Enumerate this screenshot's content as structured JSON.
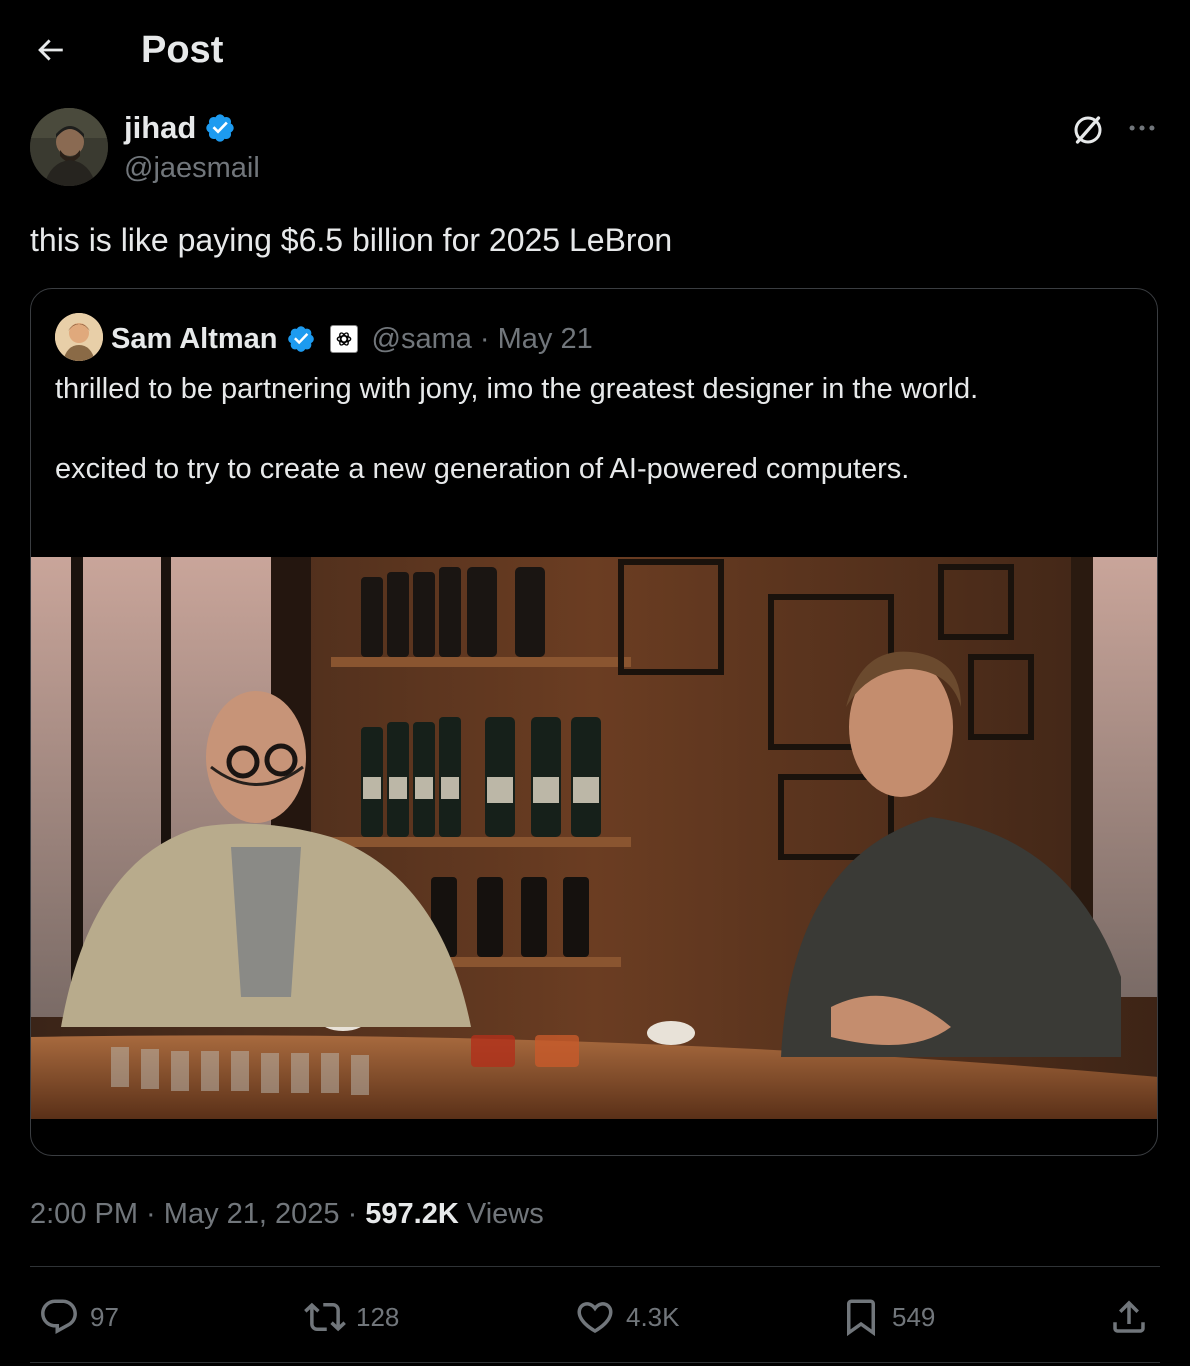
{
  "header": {
    "title": "Post",
    "back_icon": "arrow-left-icon"
  },
  "author": {
    "name": "jihad",
    "handle": "@jaesmail",
    "verified": true,
    "verified_color": "#1d9bf0"
  },
  "post": {
    "text": "this is like paying $6.5 billion for 2025 LeBron"
  },
  "quote": {
    "name": "Sam Altman",
    "verified": true,
    "affiliate_icon": "openai-logo-icon",
    "handle": "@sama",
    "date": "· May 21",
    "text_line1": "thrilled to be partnering with jony, imo the greatest designer in the world.",
    "text_line2": "excited to try to create a new generation of AI-powered computers."
  },
  "meta": {
    "time": "2:00 PM",
    "sep1": " · ",
    "date": "May 21, 2025",
    "sep2": " · ",
    "views_count": "597.2K",
    "views_label": " Views"
  },
  "actions": {
    "replies": "97",
    "reposts": "128",
    "likes": "4.3K",
    "bookmarks": "549"
  },
  "colors": {
    "background": "#000000",
    "text": "#e7e9ea",
    "muted": "#71767b",
    "border": "#2f3336",
    "accent": "#1d9bf0"
  }
}
